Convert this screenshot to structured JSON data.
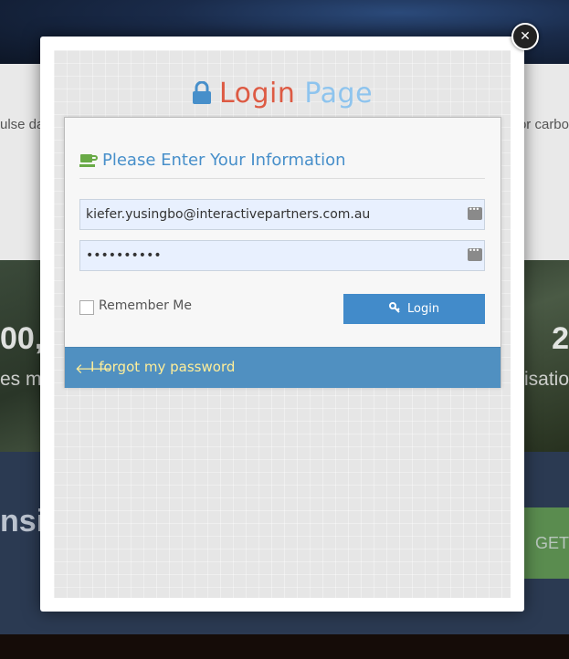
{
  "background": {
    "left_paragraph": "ulse da",
    "right_paragraph": "or carbo",
    "left_stat": "00,",
    "right_stat": "2",
    "left_stat_sub": "es me",
    "right_stat_sub": "isatio",
    "navy_heading": "nsi",
    "cta": "GET IN"
  },
  "modal": {
    "close_glyph": "✕",
    "title_part1": "Login",
    "title_part2": "Page",
    "form_heading": "Please Enter Your Information",
    "email_value": "kiefer.yusingbo@interactivepartners.com.au",
    "password_value": "••••••••••",
    "remember_label": "Remember Me",
    "login_label": "Login",
    "forgot_label": "I forgot my password"
  },
  "colors": {
    "title_login": "#dd5a43",
    "title_page": "#8ec4ee",
    "heading": "#478fca",
    "login_button": "#428bca",
    "forgot_bar": "#5090c1",
    "forgot_text": "#ffee99"
  },
  "icons": {
    "title": "lock-icon",
    "heading": "coffee-icon",
    "login": "key-icon",
    "forgot": "arrow-left-icon",
    "field": "keyboard-icon",
    "close": "close-icon"
  }
}
